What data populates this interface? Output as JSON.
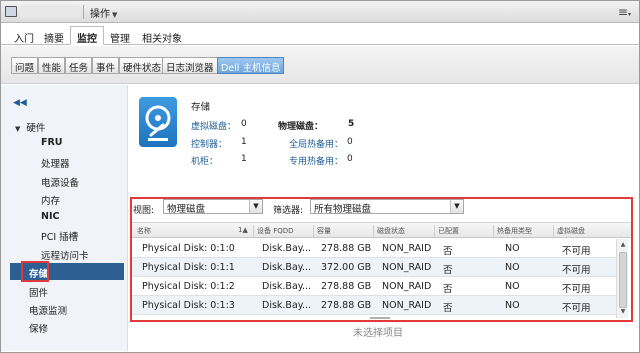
{
  "topbar": {
    "host_name": "████████",
    "action_menu": "操作"
  },
  "tabs1": [
    {
      "label": "入门"
    },
    {
      "label": "摘要"
    },
    {
      "label": "监控"
    },
    {
      "label": "管理"
    },
    {
      "label": "相关对象"
    }
  ],
  "tabs2": [
    {
      "label": "问题"
    },
    {
      "label": "性能"
    },
    {
      "label": "任务"
    },
    {
      "label": "事件"
    },
    {
      "label": "硬件状态"
    },
    {
      "label": "日志浏览器"
    },
    {
      "label": "Dell 主机信息"
    }
  ],
  "nav": {
    "group": "硬件",
    "items": [
      {
        "label": "FRU"
      },
      {
        "label": "处理器"
      },
      {
        "label": "电源设备"
      },
      {
        "label": "内存"
      },
      {
        "label": "NIC"
      },
      {
        "label": "PCI 插槽"
      },
      {
        "label": "远程访问卡"
      }
    ],
    "selected": "存储",
    "top_items": [
      {
        "label": "固件"
      },
      {
        "label": "电源监测"
      },
      {
        "label": "保修"
      }
    ]
  },
  "summary": {
    "title": "存储",
    "left": [
      {
        "label": "虚拟磁盘：",
        "value": "0"
      },
      {
        "label": "控制器：",
        "value": "1"
      },
      {
        "label": "机柜：",
        "value": "1"
      }
    ],
    "right": [
      {
        "label": "物理磁盘：",
        "value": "5"
      },
      {
        "label": "全局热备用：",
        "value": "0"
      },
      {
        "label": "专用热备用：",
        "value": "0"
      }
    ]
  },
  "filters": {
    "view_label": "视图:",
    "view_value": "物理磁盘",
    "filter_label": "筛选器:",
    "filter_value": "所有物理磁盘"
  },
  "grid": {
    "headers": [
      "名称",
      "1▲",
      "设备 FQDD",
      "容量",
      "磁盘状态",
      "已配置",
      "热备用类型",
      "虚拟磁盘"
    ],
    "rows": [
      {
        "name": "Physical Disk: 0:1:0",
        "fqdd": "Disk.Bay....",
        "capacity": "278.88 GB",
        "status": "NON_RAID",
        "configured": "否",
        "hotspare": "NO",
        "vdisk": "不可用"
      },
      {
        "name": "Physical Disk: 0:1:1",
        "fqdd": "Disk.Bay....",
        "capacity": "372.00 GB",
        "status": "NON_RAID",
        "configured": "否",
        "hotspare": "NO",
        "vdisk": "不可用"
      },
      {
        "name": "Physical Disk: 0:1:2",
        "fqdd": "Disk.Bay....",
        "capacity": "278.88 GB",
        "status": "NON_RAID",
        "configured": "否",
        "hotspare": "NO",
        "vdisk": "不可用"
      },
      {
        "name": "Physical Disk: 0:1:3",
        "fqdd": "Disk.Bay....",
        "capacity": "278.88 GB",
        "status": "NON_RAID",
        "configured": "否",
        "hotspare": "NO",
        "vdisk": "不可用"
      }
    ]
  },
  "empty_note": "未选择项目",
  "colors": {
    "accent": "#2e5f93",
    "highlight_box": "#e03a3a",
    "link": "#1f5d99"
  }
}
